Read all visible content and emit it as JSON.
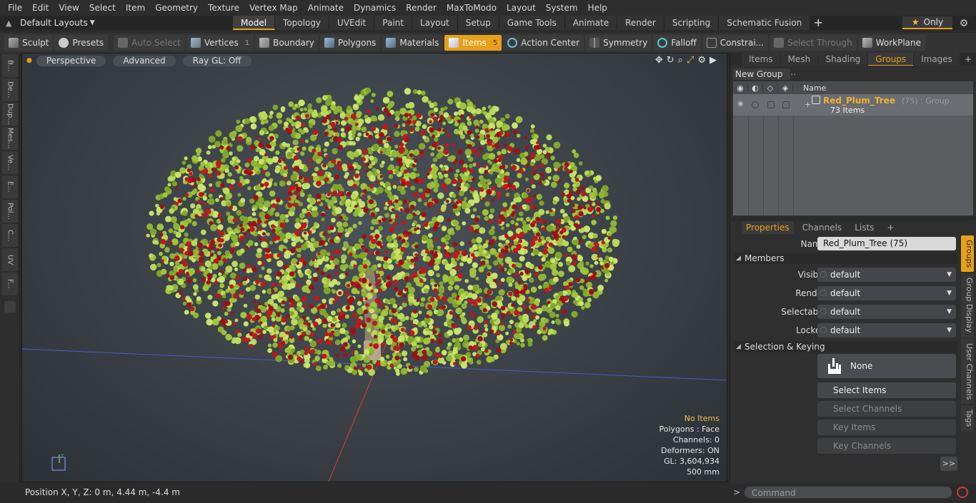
{
  "menu": [
    "File",
    "Edit",
    "View",
    "Select",
    "Item",
    "Geometry",
    "Texture",
    "Vertex Map",
    "Animate",
    "Dynamics",
    "Render",
    "MaxToModo",
    "Layout",
    "System",
    "Help"
  ],
  "layout_menu": "Default Layouts",
  "layout_tabs": [
    "Model",
    "Topology",
    "UVEdit",
    "Paint",
    "Layout",
    "Setup",
    "Game Tools",
    "Animate",
    "Render",
    "Scripting",
    "Schematic Fusion"
  ],
  "active_tab": "Model",
  "only_label": "Only",
  "toolbar": {
    "sculpt": "Sculpt",
    "presets": "Presets",
    "auto_select": "Auto Select",
    "vertices": "Vertices",
    "vertices_count": "1",
    "boundary": "Boundary",
    "polygons": "Polygons",
    "materials": "Materials",
    "items": "Items",
    "items_count": "5",
    "action_center": "Action Center",
    "symmetry": "Symmetry",
    "falloff": "Falloff",
    "constraints": "Constrai...",
    "select_through": "Select Through",
    "workplane": "WorkPlane"
  },
  "left_tabs": [
    "B...",
    "De...",
    "Dup...",
    "Mes...",
    "Ve...",
    "E...",
    "Pol...",
    "C...",
    "UV",
    "F..."
  ],
  "viewport": {
    "view": "Perspective",
    "shading": "Advanced",
    "raygl": "Ray GL: Off",
    "hud": {
      "items": "No Items",
      "polygons": "Polygons : Face",
      "channels": "Channels: 0",
      "deformers": "Deformers: ON",
      "gl": "GL: 3,604,934",
      "scale": "500 mm"
    }
  },
  "top_panel": {
    "tabs": [
      "Items",
      "Mesh ...",
      "Shading",
      "Groups",
      "Images"
    ],
    "active": "Groups",
    "new_group": "New Group",
    "col_name": "Name",
    "group": {
      "name": "Red_Plum_Tree",
      "meta": "(75) : Group",
      "count": "73 Items"
    }
  },
  "properties": {
    "tabs": [
      "Properties",
      "Channels",
      "Lists"
    ],
    "active": "Properties",
    "name_label": "Name",
    "name_value": "Red_Plum_Tree (75)",
    "members_section": "Members",
    "visible_label": "Visible",
    "visible_value": "default",
    "render_label": "Render",
    "render_value": "default",
    "selectable_label": "Selectable",
    "selectable_value": "default",
    "locked_label": "Locked",
    "locked_value": "default",
    "selkey_section": "Selection & Keying",
    "none_btn": "None",
    "select_items": "Select Items",
    "select_channels": "Select Channels",
    "key_items": "Key Items",
    "key_channels": "Key Channels",
    "more": ">>",
    "side_tabs": [
      "Groups",
      "Group Display",
      "User Channels",
      "Tags"
    ]
  },
  "status": "Position X, Y, Z:   0 m, 4.44 m, -4.4 m",
  "command": {
    "prompt": ">",
    "placeholder": "Command"
  }
}
